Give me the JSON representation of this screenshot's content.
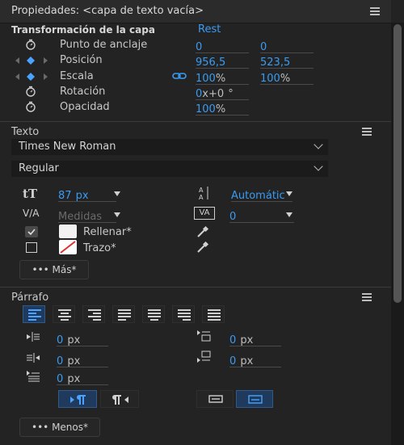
{
  "header": {
    "title": "Propiedades: <capa de texto vacía>"
  },
  "transform": {
    "title": "Transformación de la capa",
    "reset": "Rest",
    "rows": [
      {
        "label": "Punto de anclaje",
        "v1": "0",
        "v2": "0"
      },
      {
        "label": "Posición",
        "v1": "956,5",
        "v2": "523,5"
      },
      {
        "label": "Escala",
        "v1": "100",
        "v1_unit": "%",
        "v2": "100",
        "v2_unit": "%"
      },
      {
        "label": "Rotación",
        "v1": "0",
        "v1_rest": "x+0",
        "v1_unit": "°"
      },
      {
        "label": "Opacidad",
        "v1": "100",
        "v1_unit": "%"
      }
    ]
  },
  "text": {
    "title": "Texto",
    "font": "Times New Roman",
    "style": "Regular",
    "size": "87",
    "size_unit": "px",
    "leading": "Automátic",
    "kerning": "Medidas",
    "tracking": "0",
    "fill_label": "Rellenar*",
    "stroke_label": "Trazo*",
    "more": "Más*"
  },
  "paragraph": {
    "title": "Párrafo",
    "indent_left": "0",
    "indent_left_unit": "px",
    "space_before": "0",
    "space_before_unit": "px",
    "indent_right": "0",
    "indent_right_unit": "px",
    "space_after": "0",
    "space_after_unit": "px",
    "first_line": "0",
    "first_line_unit": "px",
    "less": "Menos*"
  },
  "colors": {
    "accent": "#3a9bf2",
    "stroke_swatch": "#e0302a",
    "fill_swatch": "#ffffff"
  }
}
